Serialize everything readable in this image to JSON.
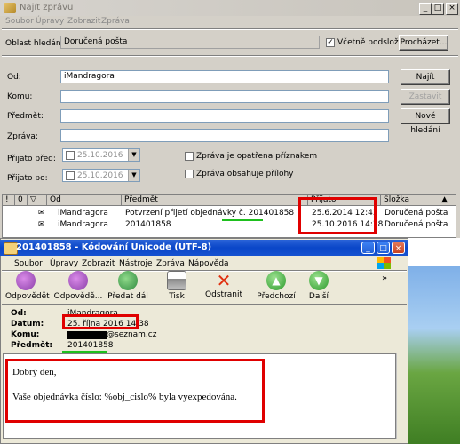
{
  "find_window": {
    "title": "Najít zprávu",
    "menu": [
      "Soubor",
      "Úpravy",
      "Zobrazit",
      "Zpráva"
    ],
    "search_area_label": "Oblast hledání:",
    "search_area_value": "Doručená pošta",
    "include_subfolders_label": "Včetně podsložek",
    "include_subfolders_checked": true,
    "browse_button": "Procházet...",
    "from_label": "Od:",
    "from_value": "iMandragora",
    "to_label": "Komu:",
    "subject_label": "Předmět:",
    "message_label": "Zpráva:",
    "received_before_label": "Přijato před:",
    "received_before_value": "25.10.2016",
    "received_after_label": "Přijato po:",
    "received_after_value": "25.10.2016",
    "flagged_label": "Zpráva je opatřena příznakem",
    "attachments_label": "Zpráva obsahuje přílohy",
    "find_button": "Najít",
    "stop_button": "Zastavit",
    "new_search_button": "Nové hledání",
    "columns": [
      "!",
      "0",
      "▽",
      "Od",
      "Předmět",
      "Přijato",
      "Složka"
    ],
    "rows": [
      {
        "from": "iMandragora",
        "subject": "Potvrzení přijetí objednávky č. 201401858",
        "received": "25.6.2014 12:43",
        "folder": "Doručená pošta"
      },
      {
        "from": "iMandragora",
        "subject": "201401858",
        "received": "25.10.2016 14:38",
        "folder": "Doručená pošta"
      }
    ]
  },
  "message_window": {
    "title": "201401858 - Kódování Unicode (UTF-8)",
    "menu": [
      "Soubor",
      "Úpravy",
      "Zobrazit",
      "Nástroje",
      "Zpráva",
      "Nápověda"
    ],
    "toolbar": [
      "Odpovědět",
      "Odpovědě...",
      "Předat dál",
      "Tisk",
      "Odstranit",
      "Předchozí",
      "Další"
    ],
    "header": {
      "from_label": "Od:",
      "from_value": "iMandragora",
      "date_label": "Datum:",
      "date_value": "25. října 2016 14:38",
      "to_label": "Komu:",
      "to_value": "@seznam.cz",
      "subject_label": "Předmět:",
      "subject_value": "201401858"
    },
    "body": {
      "greeting": "Dobrý den,",
      "line": "Vaše objednávka číslo: %obj_cislo% byla vyexpedována."
    }
  },
  "colors": {
    "highlight_red": "#e00000",
    "underline_green": "#1ec01e",
    "xp_title_blue": "#0a46c8"
  }
}
